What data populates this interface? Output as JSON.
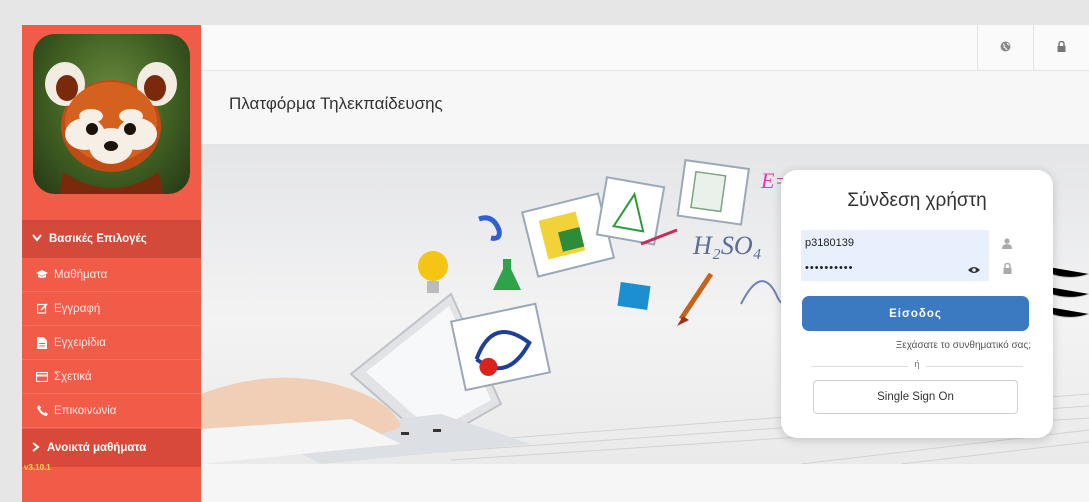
{
  "page": {
    "title": "Πλατφόρμα Τηλεκπαίδευσης"
  },
  "sidebar": {
    "section_main": "Βασικές Επιλογές",
    "items": [
      {
        "label": "Μαθήματα",
        "icon": "graduation-cap-icon"
      },
      {
        "label": "Εγγραφή",
        "icon": "edit-icon"
      },
      {
        "label": "Εγχειρίδια",
        "icon": "file-icon"
      },
      {
        "label": "Σχετικά",
        "icon": "card-icon"
      },
      {
        "label": "Επικοινωνία",
        "icon": "phone-icon"
      }
    ],
    "section_open": "Ανοικτά μαθήματα",
    "version": "v3.10.1"
  },
  "topbar": {
    "icons": [
      "globe-icon",
      "lock-icon"
    ]
  },
  "login": {
    "title": "Σύνδεση χρήστη",
    "username_value": "p3180139",
    "password_value": "••••••••••",
    "submit_label": "Είσοδος",
    "forgot_label": "Ξεχάσατε το συνθηματικό σας;",
    "or_label": "ή",
    "sso_label": "Single Sign On"
  },
  "colors": {
    "sidebar": "#f15c49",
    "sidebar_section": "#d34a3a",
    "primary_button": "#3b79c0",
    "version_text": "#ffe23c"
  }
}
